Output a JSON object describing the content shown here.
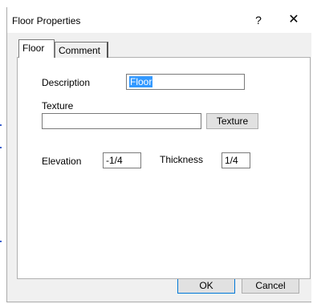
{
  "window": {
    "title": "Floor Properties",
    "help_label": "?",
    "close_label": "✕"
  },
  "tabs": [
    {
      "label": "Floor",
      "active": true
    },
    {
      "label": "Comment",
      "active": false
    }
  ],
  "floor": {
    "description_label": "Description",
    "description_value": "Floor",
    "texture_label": "Texture",
    "texture_value": "",
    "texture_button": "Texture",
    "elevation_label": "Elevation",
    "elevation_value": "-1/4",
    "thickness_label": "Thickness",
    "thickness_value": "1/4"
  },
  "footer": {
    "ok_label": "OK",
    "cancel_label": "Cancel"
  },
  "colors": {
    "dialog_bg": "#f0f0f0",
    "selection": "#3399ff",
    "default_button_border": "#0078d7"
  }
}
